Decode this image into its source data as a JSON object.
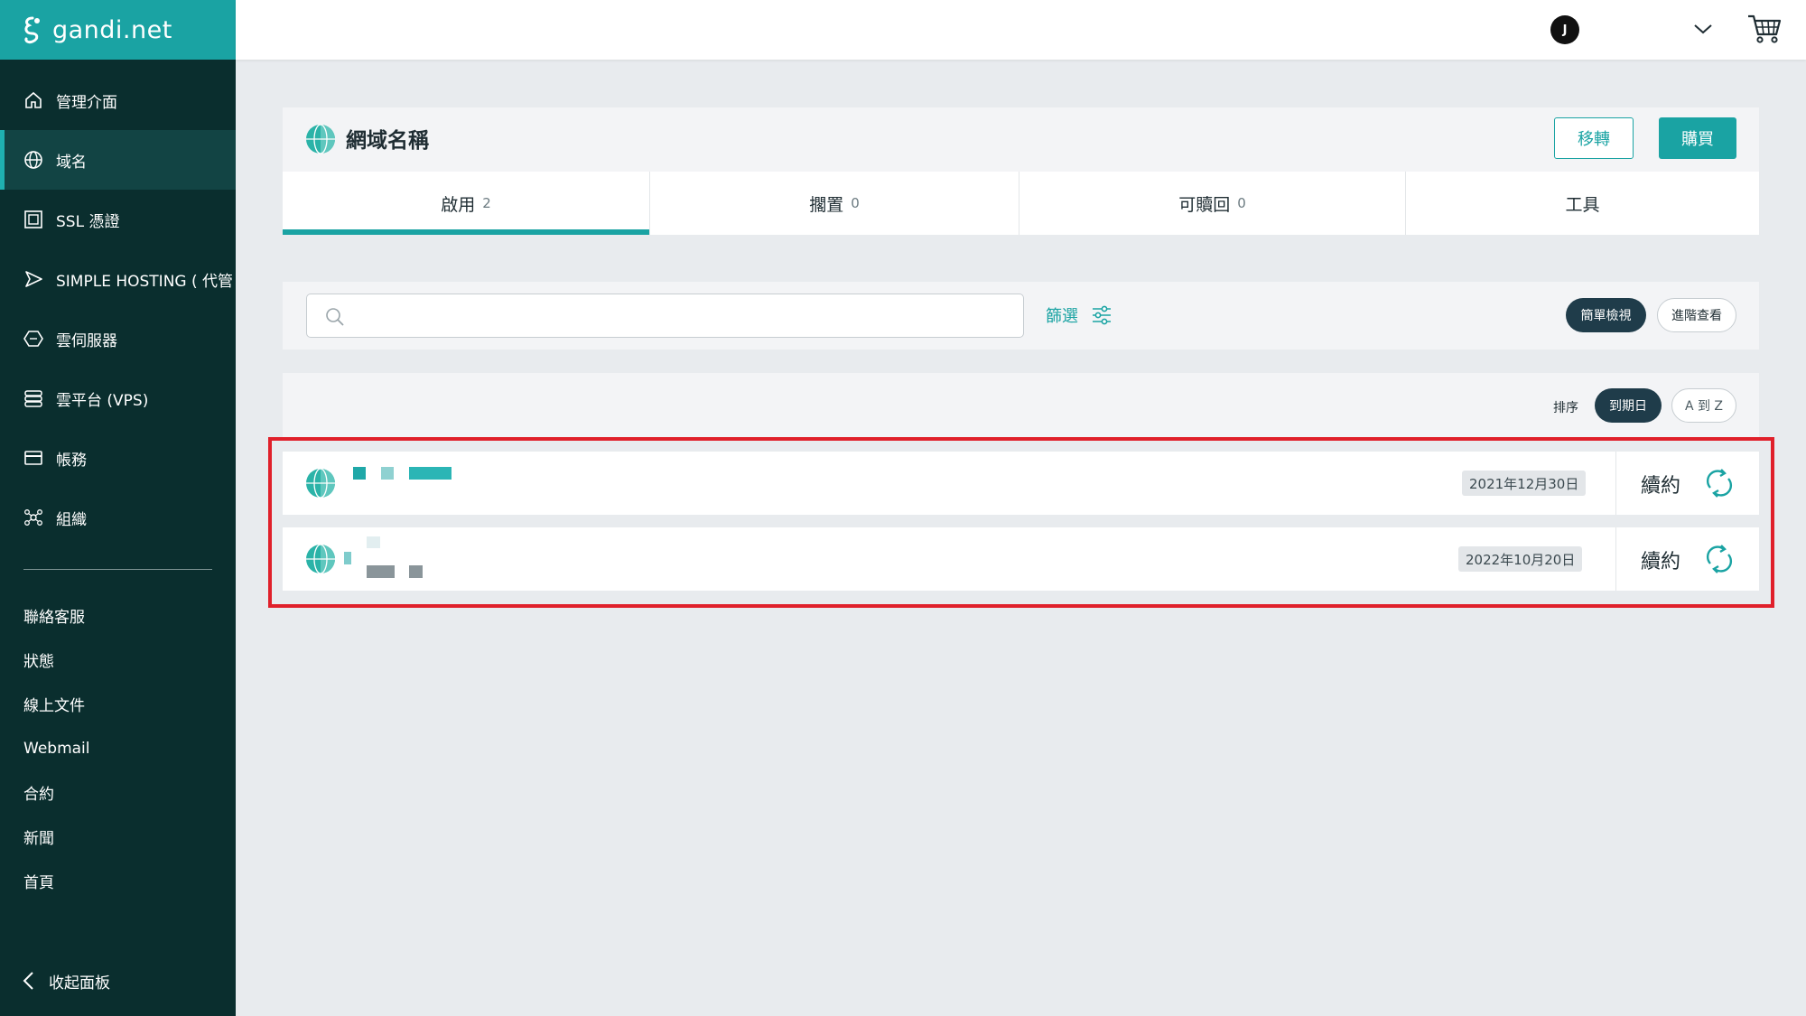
{
  "brand": {
    "name": "gandi.net"
  },
  "sidebar": {
    "items": [
      {
        "label": "管理介面",
        "icon": "home-icon"
      },
      {
        "label": "域名",
        "icon": "globe-icon",
        "active": true
      },
      {
        "label": "SSL 憑證",
        "icon": "certificate-icon"
      },
      {
        "label": "SIMPLE HOSTING ( 代管",
        "icon": "send-icon"
      },
      {
        "label": "雲伺服器",
        "icon": "cloud-server-icon"
      },
      {
        "label": "雲平台 (VPS)",
        "icon": "server-stack-icon"
      },
      {
        "label": "帳務",
        "icon": "card-icon"
      },
      {
        "label": "組織",
        "icon": "organization-icon"
      }
    ],
    "links": [
      "聯絡客服",
      "狀態",
      "線上文件",
      "Webmail",
      "合約",
      "新聞",
      "首頁"
    ],
    "collapse_label": "收起面板"
  },
  "topbar": {
    "avatar_initial": "J"
  },
  "header": {
    "title": "網域名稱",
    "transfer_label": "移轉",
    "buy_label": "購買"
  },
  "tabs": [
    {
      "label": "啟用",
      "count": "2"
    },
    {
      "label": "擱置",
      "count": "0"
    },
    {
      "label": "可贖回",
      "count": "0"
    },
    {
      "label": "工具",
      "count": ""
    }
  ],
  "filter": {
    "search_placeholder": "",
    "filter_label": "篩選",
    "simple_view_label": "簡單檢視",
    "advanced_view_label": "進階查看"
  },
  "sort": {
    "label": "排序",
    "by_expiry_label": "到期日",
    "alpha_label": "A 到 Z"
  },
  "domains": [
    {
      "expiry": "2021年12月30日",
      "renew_label": "續約"
    },
    {
      "expiry": "2022年10月20日",
      "renew_label": "續約"
    }
  ],
  "colors": {
    "accent": "#1aa3a3",
    "sidebar_bg": "#0a2e2e",
    "highlight": "#e0202a"
  }
}
